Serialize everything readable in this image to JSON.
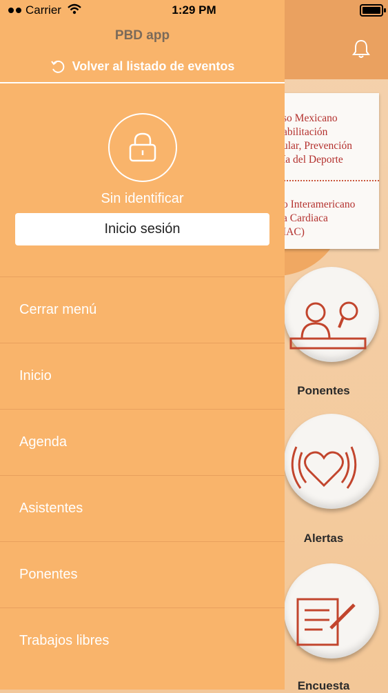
{
  "status_bar": {
    "carrier": "Carrier",
    "time": "1:29 PM"
  },
  "drawer": {
    "app_title": "PBD app",
    "back_label": "Volver al listado de eventos",
    "user_status": "Sin identificar",
    "login_button": "Inicio sesión",
    "menu_items": [
      "Cerrar menú",
      "Inicio",
      "Agenda",
      "Asistentes",
      "Ponentes",
      "Trabajos libres"
    ]
  },
  "background": {
    "banner_lines": [
      "so Mexicano",
      "abilitación",
      "ular, Prevención",
      "ía del Deporte",
      "o Interamericano",
      "a Cardiaca",
      "IAC)"
    ],
    "buttons": [
      "Ponentes",
      "Alertas",
      "Encuesta"
    ]
  },
  "colors": {
    "drawer": "#f9b46b",
    "header": "#eaa160",
    "accent_red": "#b3302d",
    "text_gray": "#7a6a5a"
  },
  "icons": {
    "bell": "bell-icon",
    "back": "refresh-icon",
    "lock": "lock-icon",
    "wifi": "wifi-icon",
    "battery": "battery-icon"
  }
}
